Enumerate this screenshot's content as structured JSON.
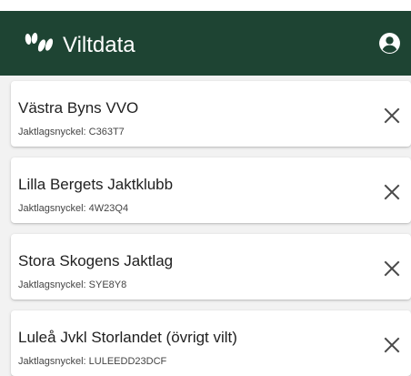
{
  "appbar": {
    "title": "Viltdata",
    "logo_icon": "hoofprint-icon",
    "account_icon": "account-circle-icon",
    "background": "#1e4433"
  },
  "teams": [
    {
      "name": "Västra Byns VVO",
      "key_label": "Jaktlagsnyckel: ",
      "key": "C363T7",
      "remove_icon": "close-icon"
    },
    {
      "name": "Lilla Bergets Jaktklubb",
      "key_label": "Jaktlagsnyckel: ",
      "key": "4W23Q4",
      "remove_icon": "close-icon"
    },
    {
      "name": "Stora Skogens Jaktlag",
      "key_label": "Jaktlagsnyckel: ",
      "key": "SYE8Y8",
      "remove_icon": "close-icon"
    },
    {
      "name": "Luleå Jvkl Storlandet (övrigt vilt)",
      "key_label": "Jaktlagsnyckel: ",
      "key": "LULEEDD23DCF",
      "remove_icon": "close-icon"
    }
  ]
}
